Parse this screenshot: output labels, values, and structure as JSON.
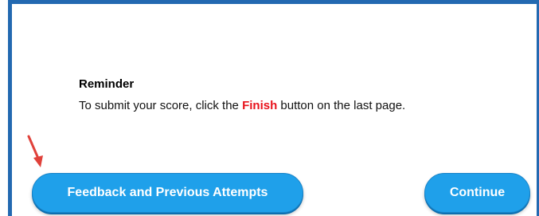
{
  "reminder": {
    "title": "Reminder",
    "text_before": "To submit your score, click the ",
    "text_highlight": "Finish",
    "text_after": " button on the last page.",
    "highlight_color": "#e8121b"
  },
  "buttons": {
    "feedback_label": "Feedback and Previous Attempts",
    "continue_label": "Continue",
    "color": "#1fa0ea"
  },
  "annotation": {
    "icon": "red-arrow-icon",
    "color": "#e0413a"
  },
  "frame": {
    "border_color": "#2369b1"
  }
}
